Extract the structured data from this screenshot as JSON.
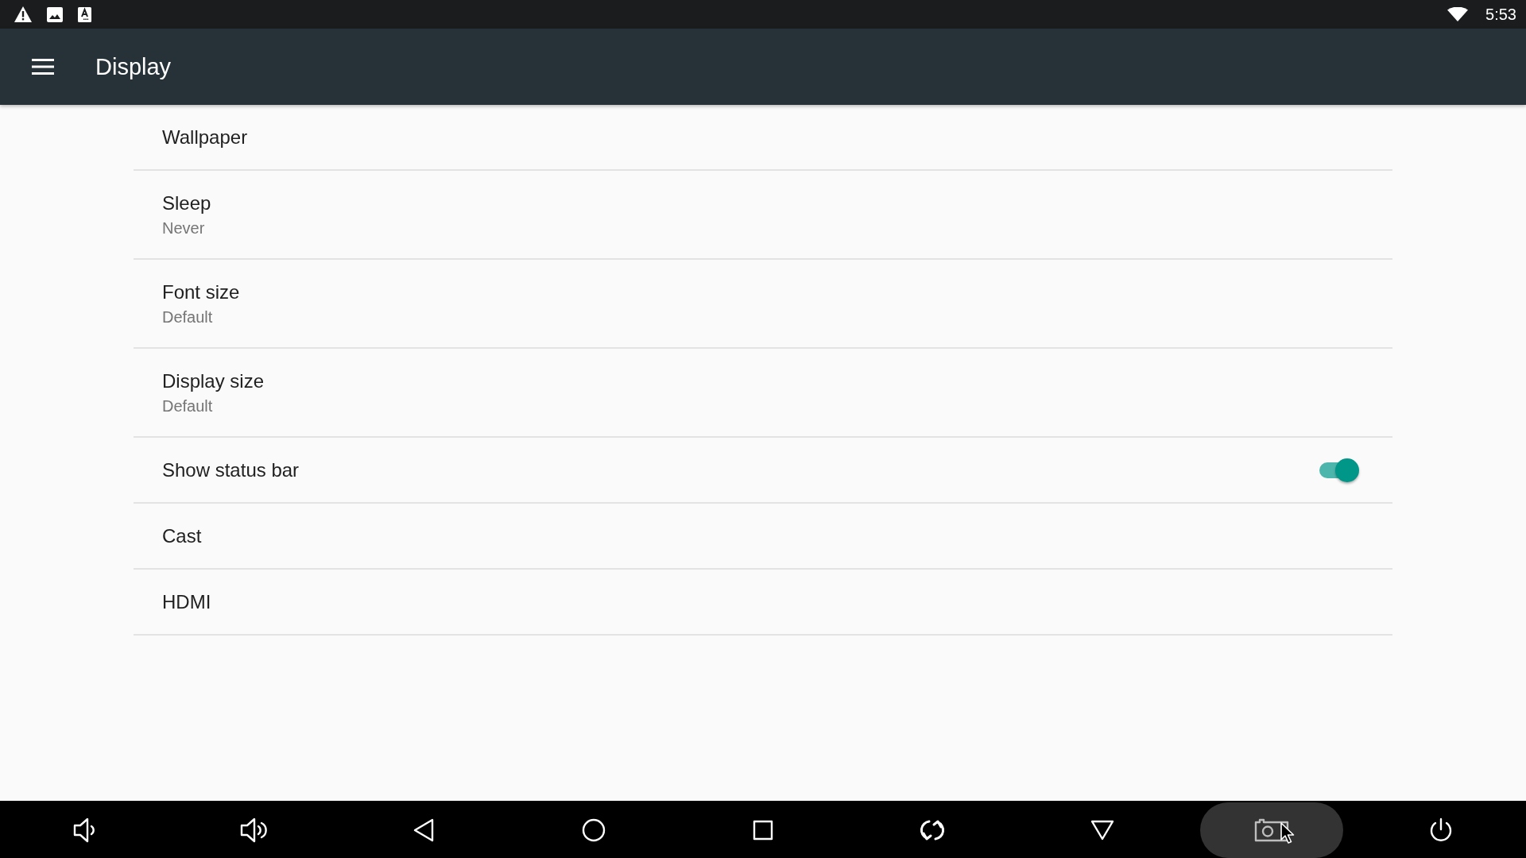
{
  "status_bar": {
    "time": "5:53"
  },
  "app_bar": {
    "title": "Display"
  },
  "settings": [
    {
      "kind": "text",
      "title": "Wallpaper"
    },
    {
      "kind": "text",
      "title": "Sleep",
      "summary": "Never"
    },
    {
      "kind": "text",
      "title": "Font size",
      "summary": "Default"
    },
    {
      "kind": "text",
      "title": "Display size",
      "summary": "Default"
    },
    {
      "kind": "switch",
      "title": "Show status bar",
      "on": true
    },
    {
      "kind": "text",
      "title": "Cast"
    },
    {
      "kind": "text",
      "title": "HDMI"
    }
  ],
  "navigation_bar": {
    "buttons": [
      {
        "pressed": false
      },
      {
        "pressed": false
      },
      {
        "pressed": false
      },
      {
        "pressed": false
      },
      {
        "pressed": false
      },
      {
        "pressed": false
      },
      {
        "pressed": false
      },
      {
        "pressed": true
      },
      {
        "pressed": false
      }
    ]
  }
}
